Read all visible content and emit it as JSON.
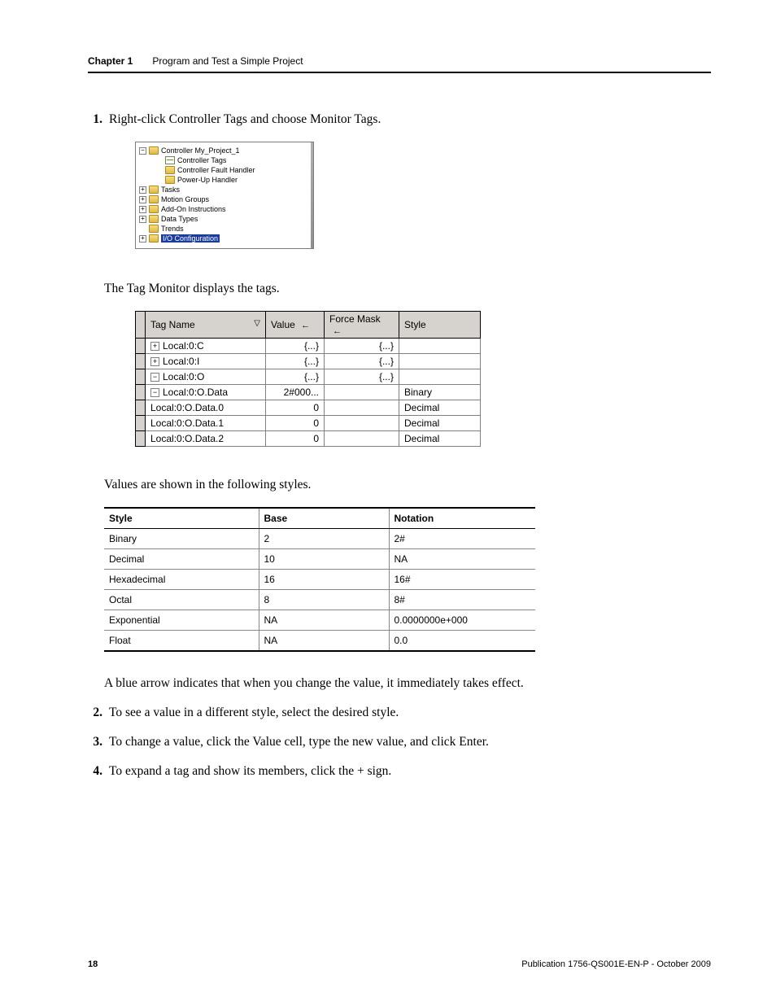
{
  "header": {
    "chapter_label": "Chapter 1",
    "chapter_title": "Program and Test a Simple Project"
  },
  "steps": {
    "s1_num": "1.",
    "s1_text": "Right-click Controller Tags and choose Monitor Tags.",
    "s2_num": "2.",
    "s2_text": "To see a value in a different style, select the desired style.",
    "s3_num": "3.",
    "s3_text": "To change a value, click the Value cell, type the new value, and click Enter.",
    "s4_num": "4.",
    "s4_text": "To expand a tag and show its members, click the + sign."
  },
  "body": {
    "after_tree": "The Tag Monitor displays the tags.",
    "after_tagmon": "Values are shown in the following styles.",
    "after_styles": "A blue arrow indicates that when you change the value, it immediately takes effect."
  },
  "tree": {
    "n0": "Controller My_Project_1",
    "n1": "Controller Tags",
    "n2": "Controller Fault Handler",
    "n3": "Power-Up Handler",
    "n4": "Tasks",
    "n5": "Motion Groups",
    "n6": "Add-On Instructions",
    "n7": "Data Types",
    "n8": "Trends",
    "n9": "I/O Configuration"
  },
  "tagmon": {
    "headers": {
      "tag": "Tag Name",
      "value": "Value",
      "force": "Force Mask",
      "style": "Style"
    },
    "rows": [
      {
        "tag": "Local:0:C",
        "exp": "+",
        "indent": 0,
        "value": "{...}",
        "force": "{...}",
        "style": ""
      },
      {
        "tag": "Local:0:I",
        "exp": "+",
        "indent": 0,
        "value": "{...}",
        "force": "{...}",
        "style": ""
      },
      {
        "tag": "Local:0:O",
        "exp": "−",
        "indent": 0,
        "value": "{...}",
        "force": "{...}",
        "style": ""
      },
      {
        "tag": "Local:0:O.Data",
        "exp": "−",
        "indent": 1,
        "value": "2#000...",
        "force": "",
        "style": "Binary"
      },
      {
        "tag": "Local:0:O.Data.0",
        "exp": "",
        "indent": 2,
        "value": "0",
        "force": "",
        "style": "Decimal"
      },
      {
        "tag": "Local:0:O.Data.1",
        "exp": "",
        "indent": 2,
        "value": "0",
        "force": "",
        "style": "Decimal"
      },
      {
        "tag": "Local:0:O.Data.2",
        "exp": "",
        "indent": 2,
        "value": "0",
        "force": "",
        "style": "Decimal"
      }
    ]
  },
  "styles_table": {
    "headers": {
      "style": "Style",
      "base": "Base",
      "notation": "Notation"
    },
    "rows": [
      {
        "style": "Binary",
        "base": "2",
        "notation": "2#"
      },
      {
        "style": "Decimal",
        "base": "10",
        "notation": "NA"
      },
      {
        "style": "Hexadecimal",
        "base": "16",
        "notation": "16#"
      },
      {
        "style": "Octal",
        "base": "8",
        "notation": "8#"
      },
      {
        "style": "Exponential",
        "base": "NA",
        "notation": "0.0000000e+000"
      },
      {
        "style": "Float",
        "base": "NA",
        "notation": "0.0"
      }
    ]
  },
  "footer": {
    "page": "18",
    "pub": "Publication 1756-QS001E-EN-P - October 2009"
  }
}
